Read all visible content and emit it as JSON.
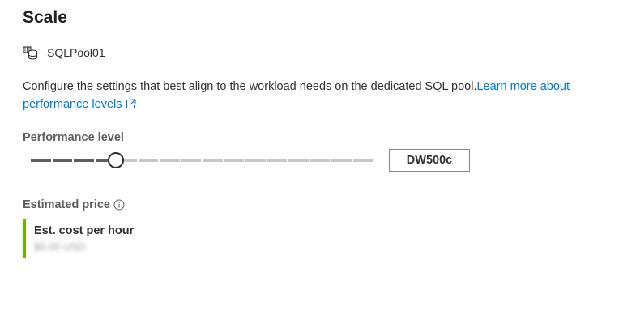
{
  "page": {
    "title": "Scale"
  },
  "resource": {
    "name": "SQLPool01",
    "icon": "sql-pool-icon"
  },
  "description": {
    "text": "Configure the settings that best align to the workload needs on the dedicated SQL pool.",
    "link_text": "Learn more about performance levels",
    "link_icon": "external-link-icon",
    "link_color": "#0078d4"
  },
  "performance": {
    "label": "Performance level",
    "value": "DW500c",
    "slider": {
      "step_count": 16,
      "selected_step": 4
    }
  },
  "price": {
    "label": "Estimated price",
    "info_icon": "info-icon",
    "cost_title": "Est. cost per hour",
    "cost_value": "$0.00 USD",
    "accent_color": "#6bb700"
  }
}
